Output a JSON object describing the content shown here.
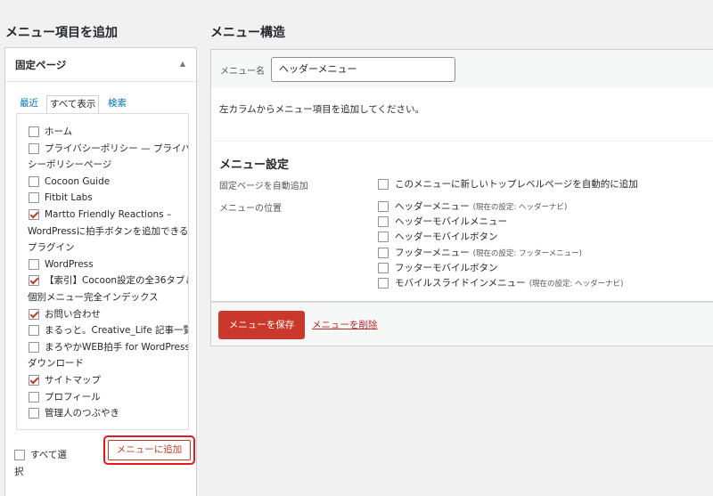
{
  "left": {
    "heading": "メニュー項目を追加",
    "accordion_title": "固定ページ",
    "tabs": [
      "最近",
      "すべて表示",
      "検索"
    ],
    "pages": [
      {
        "label": "ホーム",
        "checked": false
      },
      {
        "label": "プライバシーポリシー — プライバ",
        "cont": "シーポリシーページ",
        "checked": false
      },
      {
        "label": "Cocoon Guide",
        "checked": false
      },
      {
        "label": "Fitbit Labs",
        "checked": false
      },
      {
        "label": "Martto Friendly Reactions –",
        "cont": "WordPressに拍手ボタンを追加できる",
        "cont2": "プラグイン",
        "checked": true
      },
      {
        "label": "WordPress",
        "checked": false
      },
      {
        "label": "【索引】Cocoon設定の全36タブ＆",
        "cont": "個別メニュー完全インデックス",
        "checked": true
      },
      {
        "label": "お問い合わせ",
        "checked": true
      },
      {
        "label": "まるっと。Creative_Life 記事一覧",
        "checked": false
      },
      {
        "label": "まろやかWEB拍手 for WordPress",
        "cont": "ダウンロード",
        "checked": false
      },
      {
        "label": "サイトマップ",
        "checked": true
      },
      {
        "label": "プロフィール",
        "checked": false
      },
      {
        "label": "管理人のつぶやき",
        "checked": false
      }
    ],
    "select_all_label": "すべて選",
    "select_all_cont": "択",
    "add_button": "メニューに追加"
  },
  "right": {
    "heading": "メニュー構造",
    "menu_name_label": "メニュー名",
    "menu_name_value": "ヘッダーメニュー",
    "instruction": "左カラムからメニュー項目を追加してください。",
    "settings_title": "メニュー設定",
    "auto_add_label": "固定ページを自動追加",
    "auto_add_option": "このメニューに新しいトップレベルページを自動的に追加",
    "location_label": "メニューの位置",
    "locations": [
      {
        "label": "ヘッダーメニュー",
        "note": "(現在の設定: ヘッダーナビ)"
      },
      {
        "label": "ヘッダーモバイルメニュー",
        "note": ""
      },
      {
        "label": "ヘッダーモバイルボタン",
        "note": ""
      },
      {
        "label": "フッターメニュー",
        "note": "(現在の設定: フッターメニュー)"
      },
      {
        "label": "フッターモバイルボタン",
        "note": ""
      },
      {
        "label": "モバイルスライドインメニュー",
        "note": "(現在の設定: ヘッダーナビ)"
      }
    ],
    "save_button": "メニューを保存",
    "delete_link": "メニューを削除"
  },
  "colors": {
    "accent_red": "#c9382b",
    "highlight_red": "#e2191e",
    "link_blue": "#0073aa"
  }
}
